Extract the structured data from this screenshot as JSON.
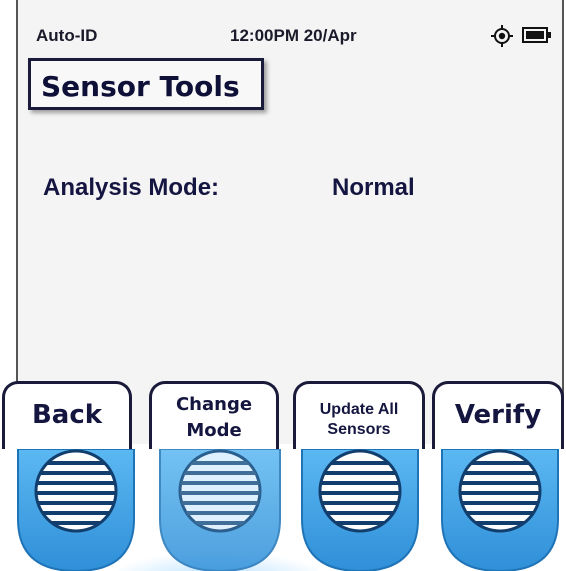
{
  "status_bar": {
    "app_name": "Auto-ID",
    "datetime": "12:00PM 20/Apr",
    "gps_icon": "gps-target-icon",
    "battery_icon": "battery-full-icon"
  },
  "page": {
    "title": "Sensor Tools",
    "analysis_label": "Analysis Mode:",
    "analysis_value": "Normal"
  },
  "softkeys": {
    "back": "Back",
    "change_mode_line1": "Change",
    "change_mode_line2": "Mode",
    "update_line1": "Update All",
    "update_line2": "Sensors",
    "verify": "Verify"
  },
  "hardware_buttons": {
    "color": "#3aa0e8",
    "pressed_index": 2
  }
}
